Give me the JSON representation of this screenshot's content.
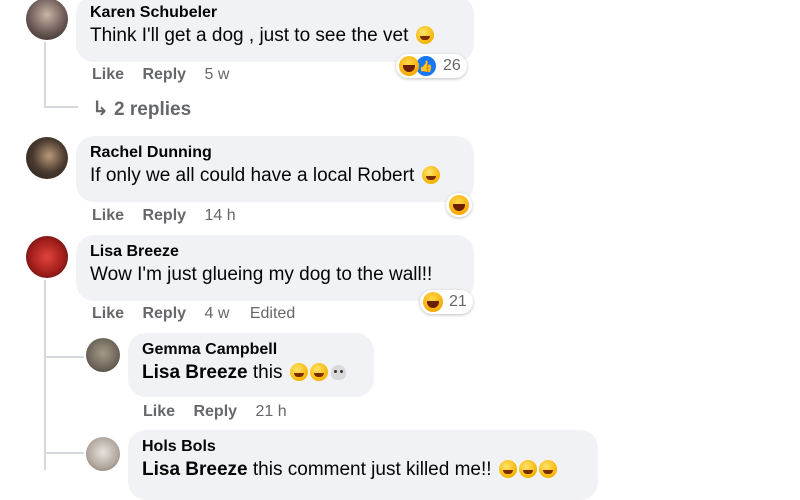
{
  "comments": [
    {
      "author": "Karen Schubeler",
      "text": "Think I'll get a dog , just to see the vet",
      "like": "Like",
      "reply": "Reply",
      "time": "5 w",
      "reaction_count": "26",
      "replies_label": "2 replies"
    },
    {
      "author": "Rachel Dunning",
      "text": "If only we all could have a local Robert",
      "like": "Like",
      "reply": "Reply",
      "time": "14 h"
    },
    {
      "author": "Lisa Breeze",
      "text": "Wow I'm just glueing my dog to the wall!!",
      "like": "Like",
      "reply": "Reply",
      "time": "4 w",
      "edited": "Edited",
      "reaction_count": "21"
    }
  ],
  "replies": [
    {
      "author": "Gemma Campbell",
      "mention": "Lisa Breeze",
      "text": "this",
      "like": "Like",
      "reply": "Reply",
      "time": "21 h"
    },
    {
      "author": "Hols Bols",
      "mention": "Lisa Breeze",
      "text": "this comment just killed me!!"
    }
  ],
  "colors": {
    "bubble": "#f0f2f5",
    "meta": "#65676b",
    "like_blue": "#1877f2"
  }
}
